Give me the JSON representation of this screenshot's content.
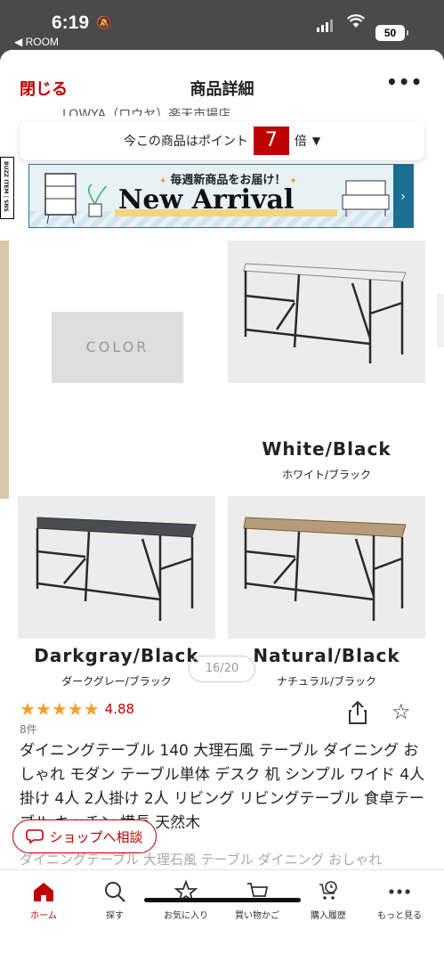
{
  "status": {
    "time": "6:19",
    "back_app": "◀ ROOM",
    "battery": "50"
  },
  "header": {
    "close": "閉じる",
    "title": "商品詳細",
    "more": "•••",
    "peek_text": "LOWYA（ロウヤ）楽天市場店"
  },
  "points": {
    "prefix": "今この商品はポイント",
    "multiplier": "7",
    "suffix": "倍"
  },
  "buzz_tag": "BUZZ ITEM | SNS",
  "banner": {
    "subtitle": "毎週新商品をお届け！",
    "title": "New Arrival",
    "arrow": "›"
  },
  "variants": {
    "color_label": "COLOR",
    "items": [
      {
        "en": "White/Black",
        "jp": "ホワイト/ブラック",
        "top_color": "#e9e9e9"
      },
      {
        "en": "Darkgray/Black",
        "jp": "ダークグレー/ブラック",
        "top_color": "#4a4c50"
      },
      {
        "en": "Natural/Black",
        "jp": "ナチュラル/ブラック",
        "top_color": "#b79a78"
      }
    ]
  },
  "image_counter": "16/20",
  "rating": {
    "stars": "★★★★★",
    "value": "4.88",
    "count": "8件"
  },
  "product_title": "ダイニングテーブル 140 大理石風 テーブル ダイニング おしゃれ モダン テーブル単体 デスク 机 シンプル ワイド 4人掛け 4人 2人掛け 2人 リビング リビングテーブル 食卓テーブル キッチン 横長 天然木",
  "description_peek": "ダイニングテーブル 大理石風 テーブル ダイニング おしゃれ",
  "shop_consult": "ショップへ相談",
  "tabs": [
    {
      "label": "ホーム",
      "icon": "home-icon"
    },
    {
      "label": "探す",
      "icon": "search-icon"
    },
    {
      "label": "お気に入り",
      "icon": "star-icon"
    },
    {
      "label": "買い物かご",
      "icon": "cart-icon"
    },
    {
      "label": "購入履歴",
      "icon": "history-icon"
    },
    {
      "label": "もっと見る",
      "icon": "more-icon"
    }
  ],
  "colors": {
    "brand_red": "#bf0000",
    "star": "#f0a030"
  }
}
